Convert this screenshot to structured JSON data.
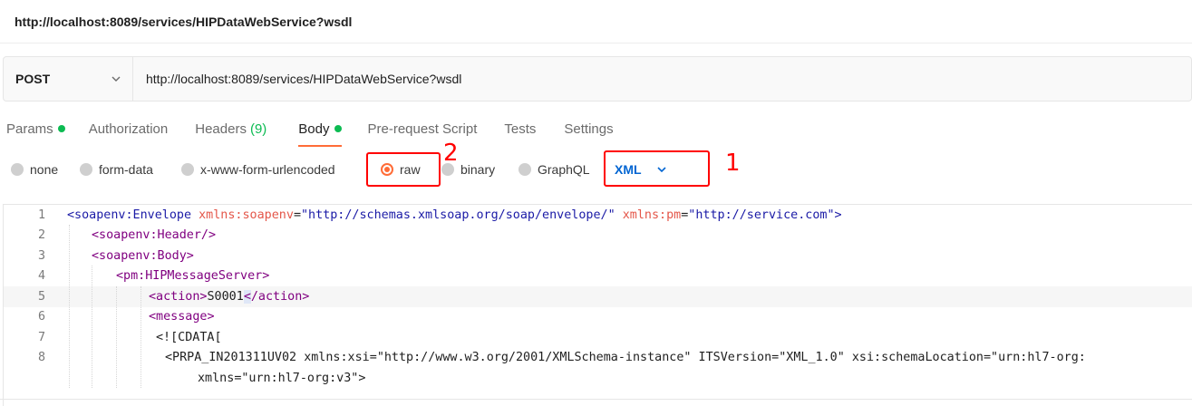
{
  "page": {
    "title": "http://localhost:8089/services/HIPDataWebService?wsdl"
  },
  "request": {
    "method": "POST",
    "url": "http://localhost:8089/services/HIPDataWebService?wsdl"
  },
  "tabs": [
    {
      "label": "Params",
      "dot": true
    },
    {
      "label": "Authorization"
    },
    {
      "label": "Headers",
      "count": "(9)"
    },
    {
      "label": "Body",
      "dot": true,
      "active": true
    },
    {
      "label": "Pre-request Script"
    },
    {
      "label": "Tests"
    },
    {
      "label": "Settings"
    }
  ],
  "body_types": [
    {
      "label": "none"
    },
    {
      "label": "form-data"
    },
    {
      "label": "x-www-form-urlencoded"
    },
    {
      "label": "raw",
      "selected": true
    },
    {
      "label": "binary"
    },
    {
      "label": "GraphQL"
    }
  ],
  "language": "XML",
  "annotations": {
    "first": "1",
    "second": "2"
  },
  "editor": {
    "line_numbers": [
      "1",
      "2",
      "3",
      "4",
      "5",
      "6",
      "7",
      "8"
    ],
    "l1": {
      "t1": "<soapenv:Envelope",
      "a1": "xmlns:soapenv",
      "v1": "\"http://schemas.xmlsoap.org/soap/envelope/\"",
      "a2": "xmlns:pm",
      "v2": "\"http://service.com\"",
      "end": ">"
    },
    "l2": "<soapenv:Header/>",
    "l3": "<soapenv:Body>",
    "l4": "<pm:HIPMessageServer>",
    "l5": {
      "open": "<action>",
      "text": "S0001",
      "lt": "<",
      "close": "/action>"
    },
    "l6": "<message>",
    "l7": "<![CDATA[",
    "l8": {
      "t1": "<PRPA_IN201311UV02",
      "a1": "xmlns:xsi",
      "v1": "\"http://www.w3.org/2001/XMLSchema-instance\"",
      "a2": "ITSVersion",
      "v2": "\"XML_1.0\"",
      "a3": "xsi:schemaLocation",
      "v3": "\"urn:hl7-org:"
    },
    "l8b": {
      "a1": "xmlns",
      "v1": "\"urn:hl7-org:v3\"",
      "end": ">"
    }
  },
  "colors": {
    "accent": "#ff6c37",
    "success": "#0cbb52",
    "link": "#0265d2",
    "annotation": "#ff0000"
  }
}
